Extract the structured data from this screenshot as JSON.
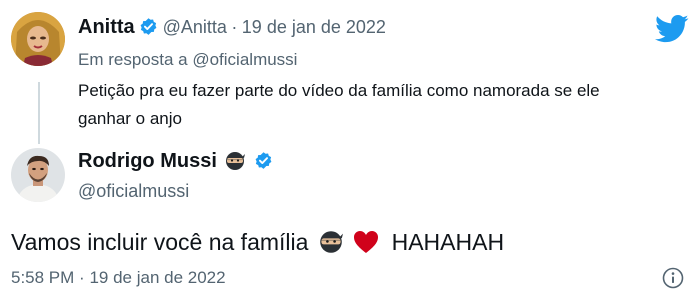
{
  "colors": {
    "accent": "#1d9bf0",
    "text": "#0f1419",
    "muted": "#536471",
    "heart": "#d0021b"
  },
  "quoted": {
    "author_name": "Anitta",
    "handle": "@Anitta",
    "separator": "·",
    "date": "19 de jan de 2022",
    "reply_prefix": "Em resposta a",
    "reply_handle": "@oficialmussi",
    "text_line1": "Petição pra eu fazer parte do vídeo da família como namorada se ele",
    "text_line2": "ganhar o anjo"
  },
  "main": {
    "author_name": "Rodrigo Mussi",
    "handle": "@oficialmussi",
    "text": "Vamos incluir você na família",
    "text_suffix": "HAHAHAH",
    "time": "5:58 PM",
    "separator": "·",
    "date": "19 de jan de 2022"
  },
  "icons": {
    "logo": "twitter-bird-icon",
    "verified": "verified-badge-icon",
    "ninja": "ninja-emoji-icon",
    "heart": "red-heart-emoji-icon",
    "info": "info-icon"
  }
}
